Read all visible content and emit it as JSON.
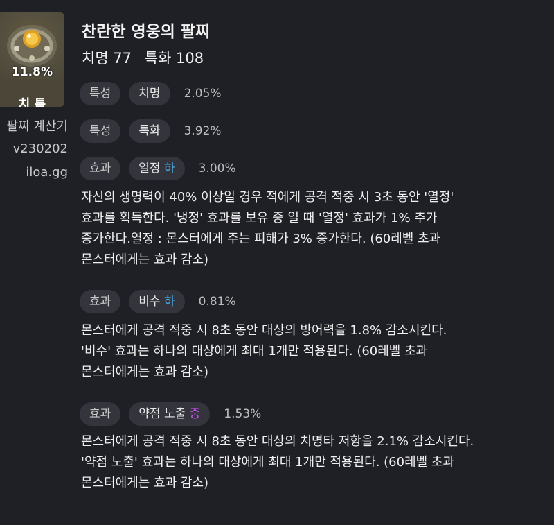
{
  "item": {
    "percent": "11.8%",
    "stat_abbr": "치 특",
    "calc_label": "팔찌 계산기",
    "version": "v230202",
    "site": "iloa.gg",
    "name": "찬란한 영웅의 팔찌",
    "stats": [
      "치명 77",
      "특화 108"
    ],
    "image_icon": "bracelet-gem-icon"
  },
  "rows": [
    {
      "type": "특성",
      "name": "치명",
      "grade": "",
      "value": "2.05%",
      "description": ""
    },
    {
      "type": "특성",
      "name": "특화",
      "grade": "",
      "value": "3.92%",
      "description": ""
    },
    {
      "type": "효과",
      "name": "열정",
      "grade": "하",
      "value": "3.00%",
      "description": "자신의 생명력이 40% 이상일 경우 적에게 공격 적중 시 3초 동안 '열정'\n효과를 획득한다. '냉정' 효과를 보유 중 일 때 '열정' 효과가 1% 추가\n증가한다.열정 : 몬스터에게 주는 피해가 3% 증가한다. (60레벨 초과\n몬스터에게는 효과 감소)"
    },
    {
      "type": "효과",
      "name": "비수",
      "grade": "하",
      "value": "0.81%",
      "description": "몬스터에게 공격 적중 시 8초 동안 대상의 방어력을 1.8% 감소시킨다.\n'비수' 효과는 하나의 대상에게 최대 1개만 적용된다. (60레벨 초과\n몬스터에게는 효과 감소)"
    },
    {
      "type": "효과",
      "name": "약점 노출",
      "grade": "중",
      "value": "1.53%",
      "description": "몬스터에게 공격 적중 시 8초 동안 대상의 치명타 저항을 2.1% 감소시킨다.\n'약점 노출' 효과는 하나의 대상에게 최대 1개만 적용된다. (60레벨 초과\n몬스터에게는 효과 감소)"
    }
  ],
  "colors": {
    "background": "#1f2026",
    "pill": "#33343c",
    "grade_low": "#4fb3f0",
    "grade_mid": "#d04ff0"
  }
}
